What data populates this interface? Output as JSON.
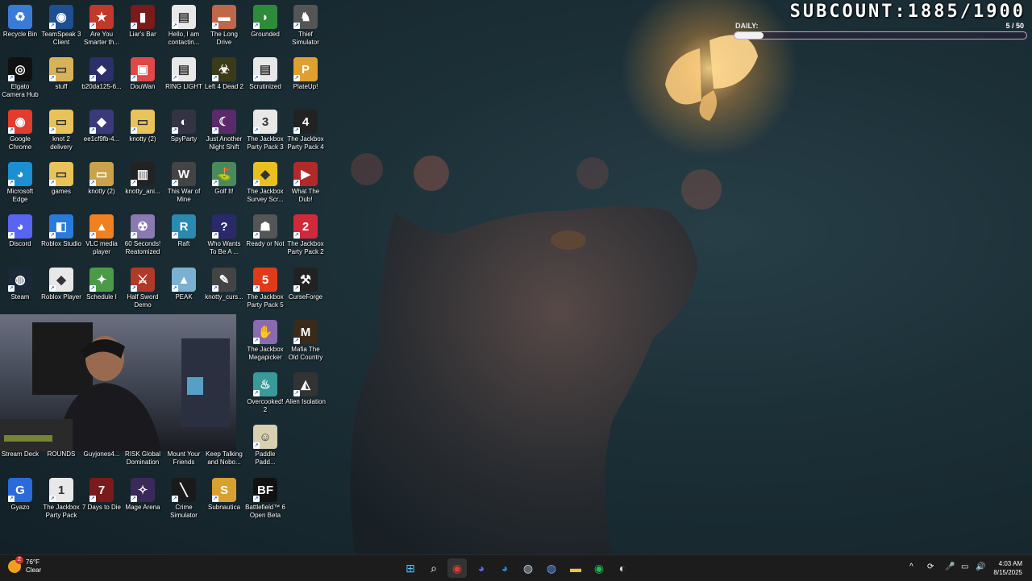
{
  "overlay": {
    "subcount": "SUBCOUNT:1885/1900",
    "daily_label": "DAILY:",
    "daily_count": "5  / 50",
    "daily_progress": 0.1
  },
  "desktop_icons": [
    {
      "label": "Recycle Bin",
      "color": "#3a7bd5",
      "glyph": "♻"
    },
    {
      "label": "TeamSpeak 3 Client",
      "color": "#1d4f91",
      "glyph": "◉"
    },
    {
      "label": "Are You Smarter th...",
      "color": "#c0392b",
      "glyph": "★"
    },
    {
      "label": "Liar's Bar",
      "color": "#7a1a1a",
      "glyph": "▮"
    },
    {
      "label": "Hello, I am contactin...",
      "color": "#e8e8e8",
      "glyph": "▤"
    },
    {
      "label": "The Long Drive",
      "color": "#c0674a",
      "glyph": "▬"
    },
    {
      "label": "Grounded",
      "color": "#2e8b3a",
      "glyph": "◗"
    },
    {
      "label": "Thief Simulator",
      "color": "#555555",
      "glyph": "♞"
    },
    {
      "label": "Elgato Camera Hub",
      "color": "#111111",
      "glyph": "◎"
    },
    {
      "label": "stuff",
      "color": "#d8b25a",
      "glyph": "▭"
    },
    {
      "label": "b20da125-6...",
      "color": "#2b2f6a",
      "glyph": "◆"
    },
    {
      "label": "DouWan",
      "color": "#e04848",
      "glyph": "▣"
    },
    {
      "label": "RING LIGHT",
      "color": "#e8e8e8",
      "glyph": "▤"
    },
    {
      "label": "Left 4 Dead 2",
      "color": "#3b3b1a",
      "glyph": "☣"
    },
    {
      "label": "Scrutinized",
      "color": "#e8e8e8",
      "glyph": "▤"
    },
    {
      "label": "PlateUp!",
      "color": "#e0a030",
      "glyph": "P"
    },
    {
      "label": "Google Chrome",
      "color": "#e33b2e",
      "glyph": "◉"
    },
    {
      "label": "knot 2 delivery",
      "color": "#e8c25a",
      "glyph": "▭"
    },
    {
      "label": "ee1cf9fb-4...",
      "color": "#3a3a7a",
      "glyph": "◆"
    },
    {
      "label": "knotty (2)",
      "color": "#e8c25a",
      "glyph": "▭"
    },
    {
      "label": "SpyParty",
      "color": "#333344",
      "glyph": "◐"
    },
    {
      "label": "Just Another Night Shift",
      "color": "#5a2a6a",
      "glyph": "☾"
    },
    {
      "label": "The Jackbox Party Pack 3",
      "color": "#e8e8e8",
      "glyph": "3"
    },
    {
      "label": "The Jackbox Party Pack 4",
      "color": "#222222",
      "glyph": "4"
    },
    {
      "label": "Microsoft Edge",
      "color": "#1b8fd1",
      "glyph": "◕"
    },
    {
      "label": "games",
      "color": "#e8c25a",
      "glyph": "▭"
    },
    {
      "label": "knotty (2)",
      "color": "#c9a24a",
      "glyph": "▭"
    },
    {
      "label": "knotty_ani...",
      "color": "#222222",
      "glyph": "▥"
    },
    {
      "label": "This War of Mine",
      "color": "#444444",
      "glyph": "W"
    },
    {
      "label": "Golf It!",
      "color": "#4a8a5a",
      "glyph": "⛳"
    },
    {
      "label": "The Jackbox Survey Scr...",
      "color": "#e8c020",
      "glyph": "◆"
    },
    {
      "label": "What The Dub!",
      "color": "#b02a2a",
      "glyph": "▶"
    },
    {
      "label": "Discord",
      "color": "#5865f2",
      "glyph": "◕"
    },
    {
      "label": "Roblox Studio",
      "color": "#2a7ad9",
      "glyph": "◧"
    },
    {
      "label": "VLC media player",
      "color": "#f08020",
      "glyph": "▲"
    },
    {
      "label": "60 Seconds! Reatomized",
      "color": "#8a7ab0",
      "glyph": "☢"
    },
    {
      "label": "Raft",
      "color": "#2a8ab0",
      "glyph": "R"
    },
    {
      "label": "Who Wants To Be A ...",
      "color": "#2a2a6a",
      "glyph": "?"
    },
    {
      "label": "Ready or Not",
      "color": "#555555",
      "glyph": "☗"
    },
    {
      "label": "The Jackbox Party Pack 2",
      "color": "#d02a3a",
      "glyph": "2"
    },
    {
      "label": "Steam",
      "color": "#1b2838",
      "glyph": "◍"
    },
    {
      "label": "Roblox Player",
      "color": "#e8e8e8",
      "glyph": "◆"
    },
    {
      "label": "Schedule I",
      "color": "#4a9a4a",
      "glyph": "✦"
    },
    {
      "label": "Half Sword Demo",
      "color": "#b03a2a",
      "glyph": "⚔"
    },
    {
      "label": "PEAK",
      "color": "#7ab0d0",
      "glyph": "▲"
    },
    {
      "label": "knotty_curs...",
      "color": "#444444",
      "glyph": "✎"
    },
    {
      "label": "The Jackbox Party Pack 5",
      "color": "#e03a1a",
      "glyph": "5"
    },
    {
      "label": "CurseForge",
      "color": "#222222",
      "glyph": "⚒"
    },
    {
      "label": "The Jackbox Megapicker",
      "color": "#8a6ab0",
      "glyph": "✋"
    },
    {
      "label": "Mafia The Old Country",
      "color": "#3a2a1a",
      "glyph": "M"
    },
    {
      "label": "Overcooked! 2",
      "color": "#3a9a9a",
      "glyph": "♨"
    },
    {
      "label": "Alien Isolation",
      "color": "#333333",
      "glyph": "◭"
    },
    {
      "label": "Stream Deck",
      "color": "#222222",
      "glyph": "▦"
    },
    {
      "label": "ROUNDS",
      "color": "#555555",
      "glyph": "●"
    },
    {
      "label": "Guyjones4...",
      "color": "#555555",
      "glyph": "▭"
    },
    {
      "label": "RISK Global Domination",
      "color": "#7a2a2a",
      "glyph": "⚑"
    },
    {
      "label": "Mount Your Friends",
      "color": "#555555",
      "glyph": "♞"
    },
    {
      "label": "Keep Talking and Nobo...",
      "color": "#555555",
      "glyph": "✹"
    },
    {
      "label": "Paddle Padd...",
      "color": "#d8d0b0",
      "glyph": "☺"
    },
    {
      "label": "Gyazo",
      "color": "#2a6ad9",
      "glyph": "G"
    },
    {
      "label": "The Jackbox Party Pack",
      "color": "#e8e8e8",
      "glyph": "1"
    },
    {
      "label": "7 Days to Die",
      "color": "#7a1a1a",
      "glyph": "7"
    },
    {
      "label": "Mage Arena",
      "color": "#3a2a5a",
      "glyph": "✧"
    },
    {
      "label": "Crime Simulator",
      "color": "#1a1a1a",
      "glyph": "╲"
    },
    {
      "label": "Subnautica",
      "color": "#d8a030",
      "glyph": "S"
    },
    {
      "label": "Battlefield™ 6 Open Beta",
      "color": "#111111",
      "glyph": "BF"
    }
  ],
  "taskbar": {
    "weather_temp": "76°F",
    "weather_desc": "Clear",
    "weather_badge": "2",
    "time": "4:03 AM",
    "date": "8/15/2025",
    "apps": [
      {
        "name": "start",
        "glyph": "⊞",
        "color": "#4cc2ff"
      },
      {
        "name": "search",
        "glyph": "⌕",
        "color": "#ffffff"
      },
      {
        "name": "chrome",
        "glyph": "◉",
        "color": "#e33b2e"
      },
      {
        "name": "discord",
        "glyph": "◕",
        "color": "#5865f2"
      },
      {
        "name": "edge",
        "glyph": "◕",
        "color": "#1b8fd1"
      },
      {
        "name": "steam",
        "glyph": "◍",
        "color": "#c7d5e0"
      },
      {
        "name": "steam-alt",
        "glyph": "◍",
        "color": "#6aa0ff"
      },
      {
        "name": "file-explorer",
        "glyph": "▬",
        "color": "#f0c040"
      },
      {
        "name": "spotify",
        "glyph": "◉",
        "color": "#1db954"
      },
      {
        "name": "obs",
        "glyph": "◐",
        "color": "#dddddd"
      }
    ],
    "tray": [
      "^",
      "⟳",
      "🎤",
      "▭",
      "🔊"
    ]
  }
}
